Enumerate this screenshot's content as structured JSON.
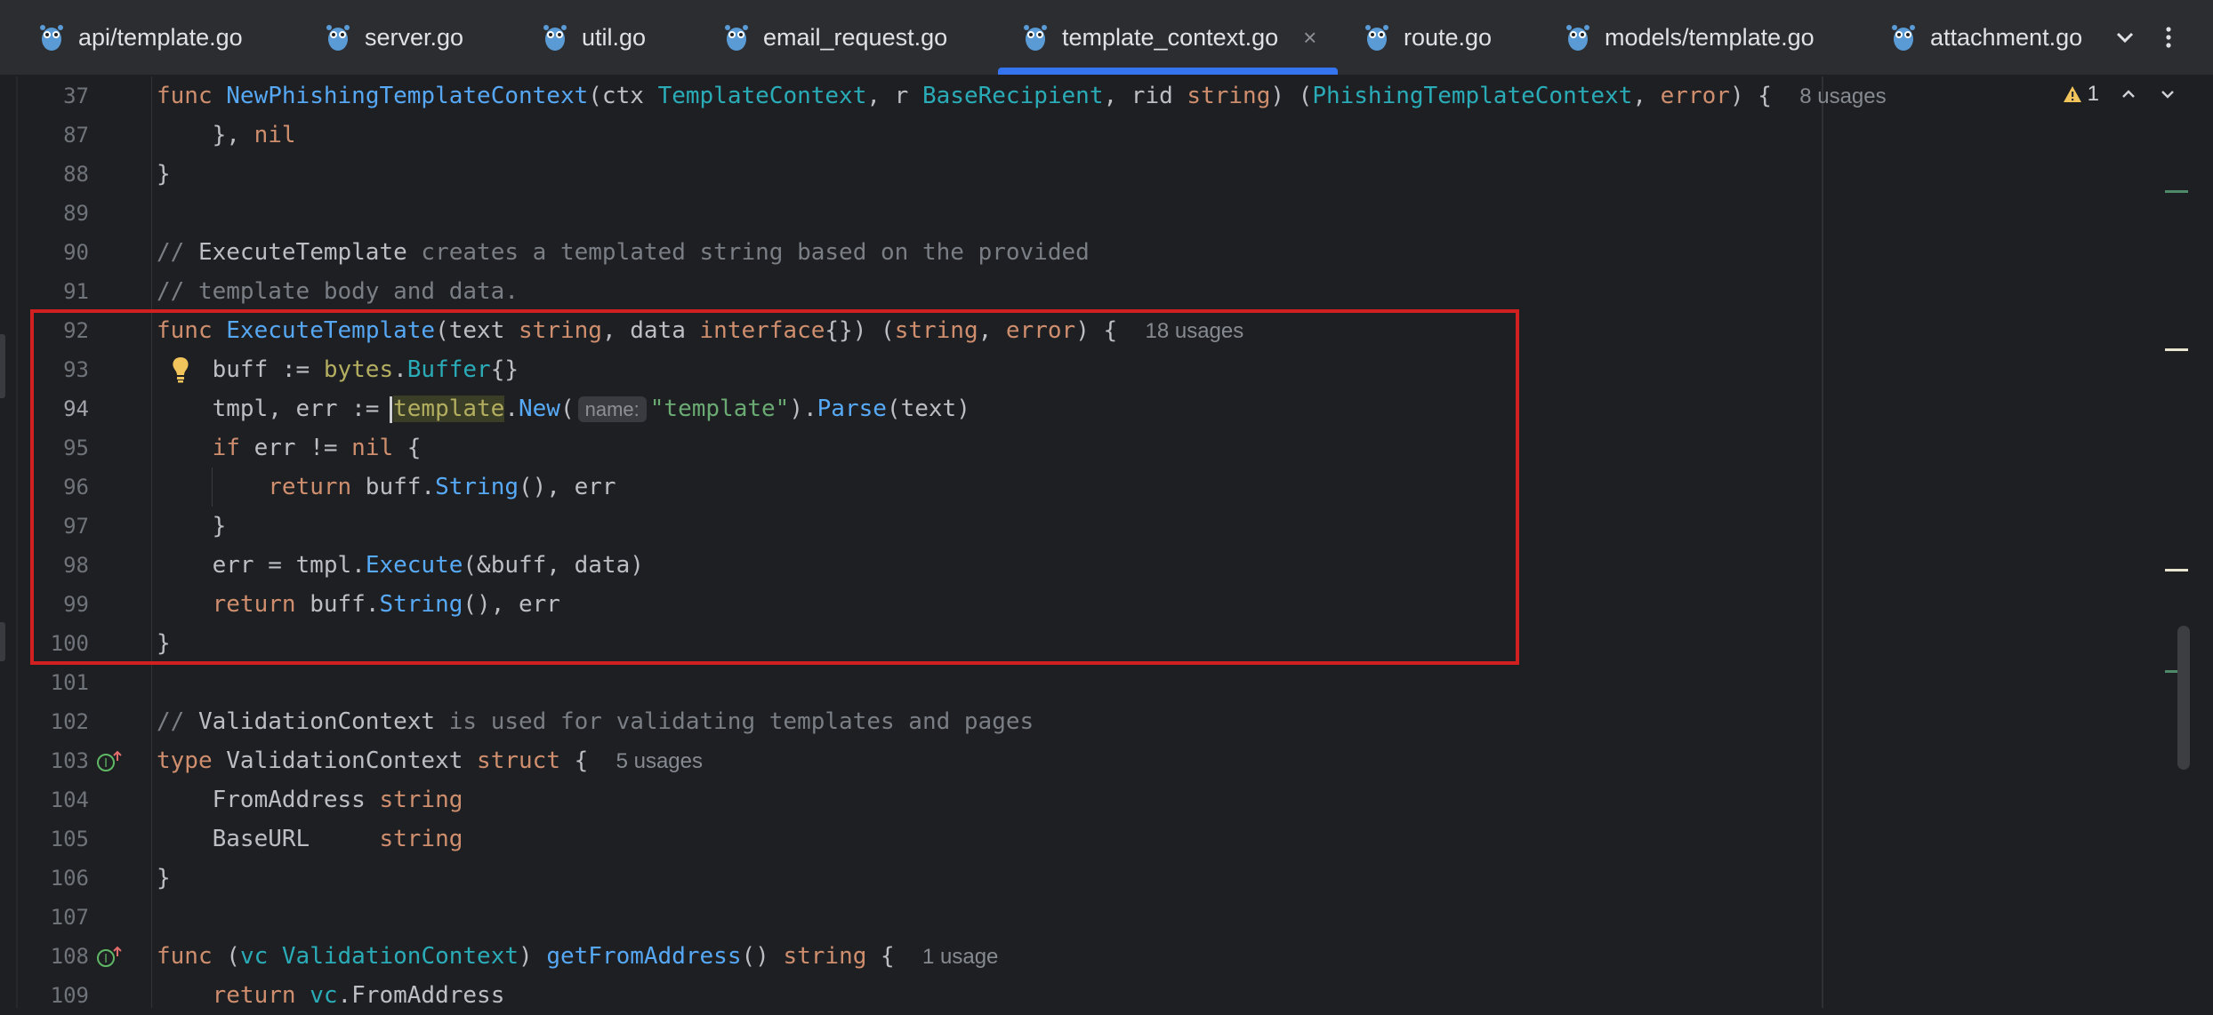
{
  "tabs": [
    {
      "label": "api/template.go"
    },
    {
      "label": "server.go"
    },
    {
      "label": "util.go"
    },
    {
      "label": "email_request.go"
    },
    {
      "label": "template_context.go",
      "active": true,
      "close": "×"
    },
    {
      "label": "route.go"
    },
    {
      "label": "models/template.go"
    },
    {
      "label": "attachment.go"
    }
  ],
  "inspections": {
    "warning_count": "1"
  },
  "sticky_line": {
    "number": "37",
    "t1": "func ",
    "name": "NewPhishingTemplateContext",
    "t2": "(ctx ",
    "ty1": "TemplateContext",
    "t3": ", r ",
    "ty2": "BaseRecipient",
    "t4": ", rid ",
    "kw1": "string",
    "t5": ") (",
    "ty3": "PhishingTemplateContext",
    "t6": ", ",
    "kw2": "error",
    "t7": ") {",
    "usages": "8 usages"
  },
  "lines": {
    "l87": {
      "number": "87",
      "t1": "    }, ",
      "kw": "nil"
    },
    "l88": {
      "number": "88",
      "t1": "}"
    },
    "l89": {
      "number": "89"
    },
    "l90": {
      "number": "90",
      "c1": "// ",
      "c2": "ExecuteTemplate",
      "c3": " creates a templated string based on the provided"
    },
    "l91": {
      "number": "91",
      "c1": "// template body and data."
    },
    "l92": {
      "number": "92",
      "kw1": "func ",
      "name": "ExecuteTemplate",
      "t1": "(text ",
      "kw2": "string",
      "t2": ", data ",
      "kw3": "interface",
      "t3": "{}) (",
      "kw4": "string",
      "t4": ", ",
      "kw5": "error",
      "t5": ") {",
      "usages": "18 usages"
    },
    "l93": {
      "number": "93",
      "t1": "    buff := ",
      "pkg": "bytes",
      "t2": ".",
      "ty": "Buffer",
      "t3": "{}"
    },
    "l94": {
      "number": "94",
      "t1": "    tmpl, err := ",
      "pkg": "template",
      "t2": ".",
      "m1": "New",
      "t3": "(",
      "hint": "name:",
      "str": "\"template\"",
      "t4": ").",
      "m2": "Parse",
      "t5": "(text)"
    },
    "l95": {
      "number": "95",
      "t1": "    ",
      "kw1": "if",
      "t2": " err != ",
      "kw2": "nil",
      "t3": " {"
    },
    "l96": {
      "number": "96",
      "t1": "        ",
      "kw": "return",
      "t2": " buff.",
      "m": "String",
      "t3": "(), err"
    },
    "l97": {
      "number": "97",
      "t1": "    }"
    },
    "l98": {
      "number": "98",
      "t1": "    err = tmpl.",
      "m": "Execute",
      "t2": "(&buff, data)"
    },
    "l99": {
      "number": "99",
      "t1": "    ",
      "kw": "return",
      "t2": " buff.",
      "m": "String",
      "t3": "(), err"
    },
    "l100": {
      "number": "100",
      "t1": "}"
    },
    "l101": {
      "number": "101"
    },
    "l102": {
      "number": "102",
      "c1": "// ",
      "c2": "ValidationContext",
      "c3": " is used for validating templates and pages"
    },
    "l103": {
      "number": "103",
      "kw1": "type ",
      "t1": "ValidationContext ",
      "kw2": "struct",
      "t2": " {",
      "usages": "5 usages"
    },
    "l104": {
      "number": "104",
      "t1": "    FromAddress ",
      "kw": "string"
    },
    "l105": {
      "number": "105",
      "t1": "    BaseURL     ",
      "kw": "string"
    },
    "l106": {
      "number": "106",
      "t1": "}"
    },
    "l107": {
      "number": "107"
    },
    "l108": {
      "number": "108",
      "kw1": "func ",
      "t1": "(",
      "ty1": "vc ",
      "ty2": "ValidationContext",
      "t2": ") ",
      "name": "getFromAddress",
      "t3": "() ",
      "kw2": "string",
      "t4": " {",
      "usages": "1 usage"
    },
    "l109": {
      "number": "109",
      "t1": "    ",
      "kw": "return",
      "t2": " ",
      "ty": "vc",
      "t3": ".FromAddress"
    }
  }
}
